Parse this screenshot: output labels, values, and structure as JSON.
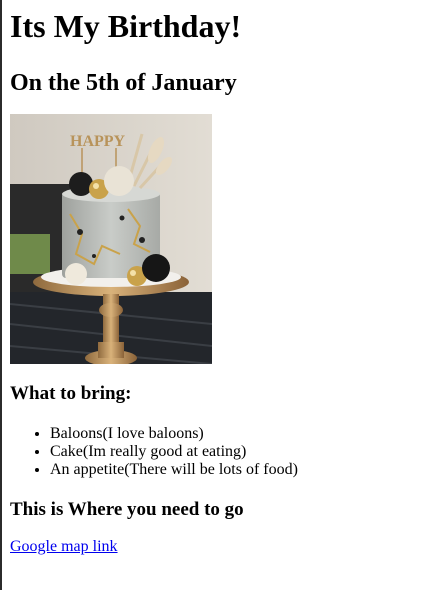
{
  "page": {
    "title": "Its My Birthday!",
    "subtitle": "On the 5th of January"
  },
  "photo": {
    "description": "cake-image",
    "topper_text": "HAPPY"
  },
  "bring": {
    "heading": "What to bring:",
    "items": [
      "Baloons(I love baloons)",
      "Cake(Im really good at eating)",
      "An appetite(There will be lots of food)"
    ]
  },
  "directions": {
    "heading": "This is Where you need to go",
    "link_text": "Google map link"
  },
  "colors": {
    "link": "#0000ee",
    "text": "#000000",
    "background": "#ffffff"
  }
}
